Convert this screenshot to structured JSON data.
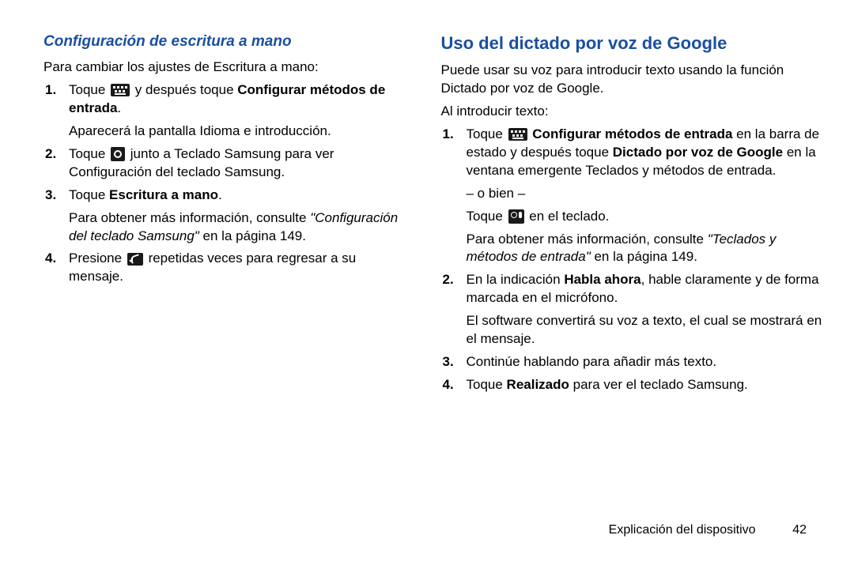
{
  "left": {
    "subhead": "Configuración de escritura a mano",
    "intro": "Para cambiar los ajustes de Escritura a mano:",
    "items": [
      {
        "num": "1.",
        "l1a": "Toque ",
        "l1b": " y después toque ",
        "l1c": "Configurar métodos de entrada",
        "l1d": ".",
        "l2": "Aparecerá la pantalla Idioma e introducción."
      },
      {
        "num": "2.",
        "l1a": "Toque ",
        "l1b": " junto a Teclado Samsung para ver Configuración del teclado Samsung."
      },
      {
        "num": "3.",
        "l1a": "Toque ",
        "l1b": "Escritura a mano",
        "l1c": ".",
        "l2a": "Para obtener más información, consulte ",
        "l2b": "\"Configuración del teclado Samsung\"",
        "l2c": " en la página 149."
      },
      {
        "num": "4.",
        "l1a": "Presione ",
        "l1b": " repetidas veces para regresar a su mensaje."
      }
    ]
  },
  "right": {
    "head": "Uso del dictado por voz de Google",
    "intro1": "Puede usar su voz para introducir texto usando la función Dictado por voz de Google.",
    "intro2": "Al introducir texto:",
    "items": [
      {
        "num": "1.",
        "l1a": "Toque ",
        "l1b": "Configurar métodos de entrada",
        "l1c": " en la barra de estado y después toque ",
        "l1d": "Dictado por voz de Google",
        "l1e": " en la ventana emergente Teclados y métodos de entrada.",
        "l2": "– o bien –",
        "l3a": "Toque ",
        "l3b": " en el teclado.",
        "l4a": "Para obtener más información, consulte ",
        "l4b": "\"Teclados y métodos de entrada\"",
        "l4c": " en la página 149."
      },
      {
        "num": "2.",
        "l1a": "En la indicación ",
        "l1b": "Habla ahora",
        "l1c": ", hable claramente y de forma marcada en el micrófono.",
        "l2": "El software convertirá su voz a texto, el cual se mostrará en el mensaje."
      },
      {
        "num": "3.",
        "l1": "Continúe hablando para añadir más texto."
      },
      {
        "num": "4.",
        "l1a": "Toque ",
        "l1b": "Realizado",
        "l1c": " para ver el teclado Samsung."
      }
    ]
  },
  "footer": {
    "label": "Explicación del dispositivo",
    "page": "42"
  }
}
